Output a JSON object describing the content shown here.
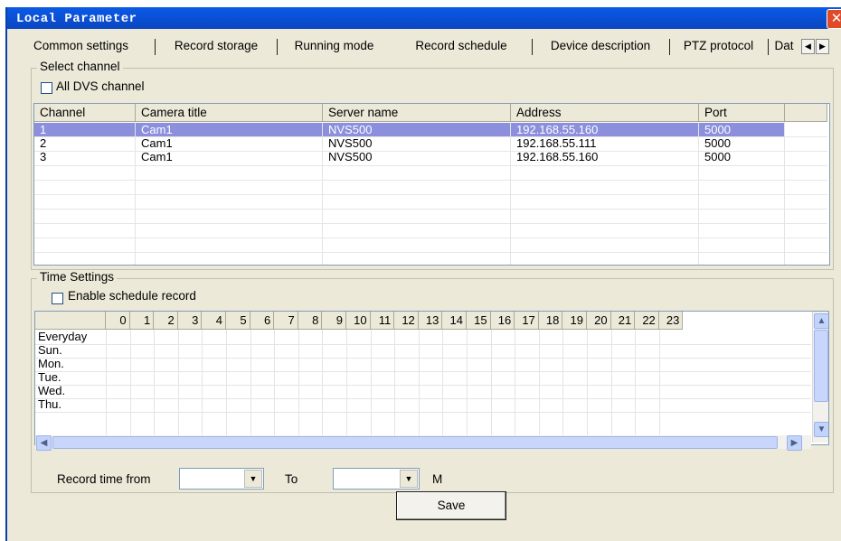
{
  "window": {
    "title": "Local Parameter",
    "close_glyph": "✕"
  },
  "tabs": [
    {
      "label": "Common settings"
    },
    {
      "label": "Record storage"
    },
    {
      "label": "Running mode"
    },
    {
      "label": "Record schedule"
    },
    {
      "label": "Device description"
    },
    {
      "label": "PTZ protocol"
    },
    {
      "label": "Dat"
    }
  ],
  "active_tab": "Record schedule",
  "select_channel": {
    "group_label": "Select channel",
    "all_dvs_label": "All DVS channel",
    "all_dvs_checked": false,
    "columns": [
      "Channel",
      "Camera title",
      "Server name",
      "Address",
      "Port"
    ],
    "rows": [
      {
        "channel": "1",
        "camera": "Cam1",
        "server": "NVS500",
        "address": "192.168.55.160",
        "port": "5000",
        "selected": true
      },
      {
        "channel": "2",
        "camera": "Cam1",
        "server": "NVS500",
        "address": "192.168.55.111",
        "port": "5000",
        "selected": false
      },
      {
        "channel": "3",
        "camera": "Cam1",
        "server": "NVS500",
        "address": "192.168.55.160",
        "port": "5000",
        "selected": false
      }
    ]
  },
  "time_settings": {
    "group_label": "Time Settings",
    "enable_label": "Enable schedule record",
    "enable_checked": false,
    "hours": [
      "0",
      "1",
      "2",
      "3",
      "4",
      "5",
      "6",
      "7",
      "8",
      "9",
      "10",
      "11",
      "12",
      "13",
      "14",
      "15",
      "16",
      "17",
      "18",
      "19",
      "20",
      "21",
      "22",
      "23"
    ],
    "days": [
      "Everyday",
      "Sun.",
      "Mon.",
      "Tue.",
      "Wed.",
      "Thu."
    ],
    "record_from_label": "Record time from",
    "from_value": "",
    "to_label": "To",
    "to_value": "",
    "unit_label": "M"
  },
  "save_label": "Save",
  "colors": {
    "selection": "#8b8fdc",
    "titlebar": "#0a4fd3",
    "close": "#e04a26"
  }
}
